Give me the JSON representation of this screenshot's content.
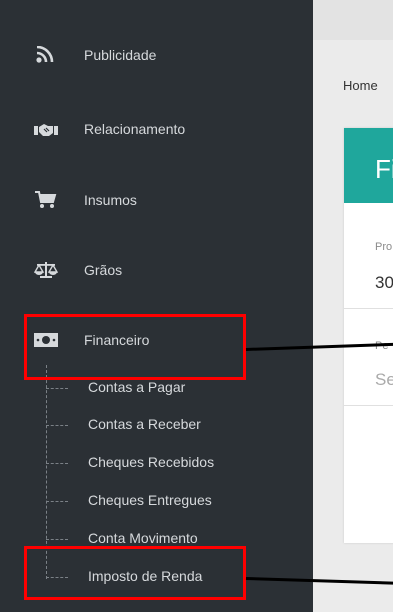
{
  "sidebar": {
    "items": [
      {
        "label": "Publicidade",
        "icon": "rss-icon"
      },
      {
        "label": "Relacionamento",
        "icon": "handshake-icon"
      },
      {
        "label": "Insumos",
        "icon": "shopping-cart-icon"
      },
      {
        "label": "Grãos",
        "icon": "balance-scale-icon"
      },
      {
        "label": "Financeiro",
        "icon": "money-bill-icon"
      }
    ],
    "financeiro_submenu": [
      "Contas a Pagar",
      "Contas a Receber",
      "Cheques Recebidos",
      "Cheques Entregues",
      "Conta Movimento",
      "Imposto de Renda"
    ]
  },
  "main": {
    "breadcrumb": "Home",
    "card_title": "Fi",
    "field1_label": "Pro",
    "field1_value": "30",
    "field2_label": "Pe",
    "field2_placeholder": "Se"
  },
  "colors": {
    "sidebar_bg": "#2b3035",
    "accent": "#1fa79c",
    "highlight": "#ff0000"
  }
}
